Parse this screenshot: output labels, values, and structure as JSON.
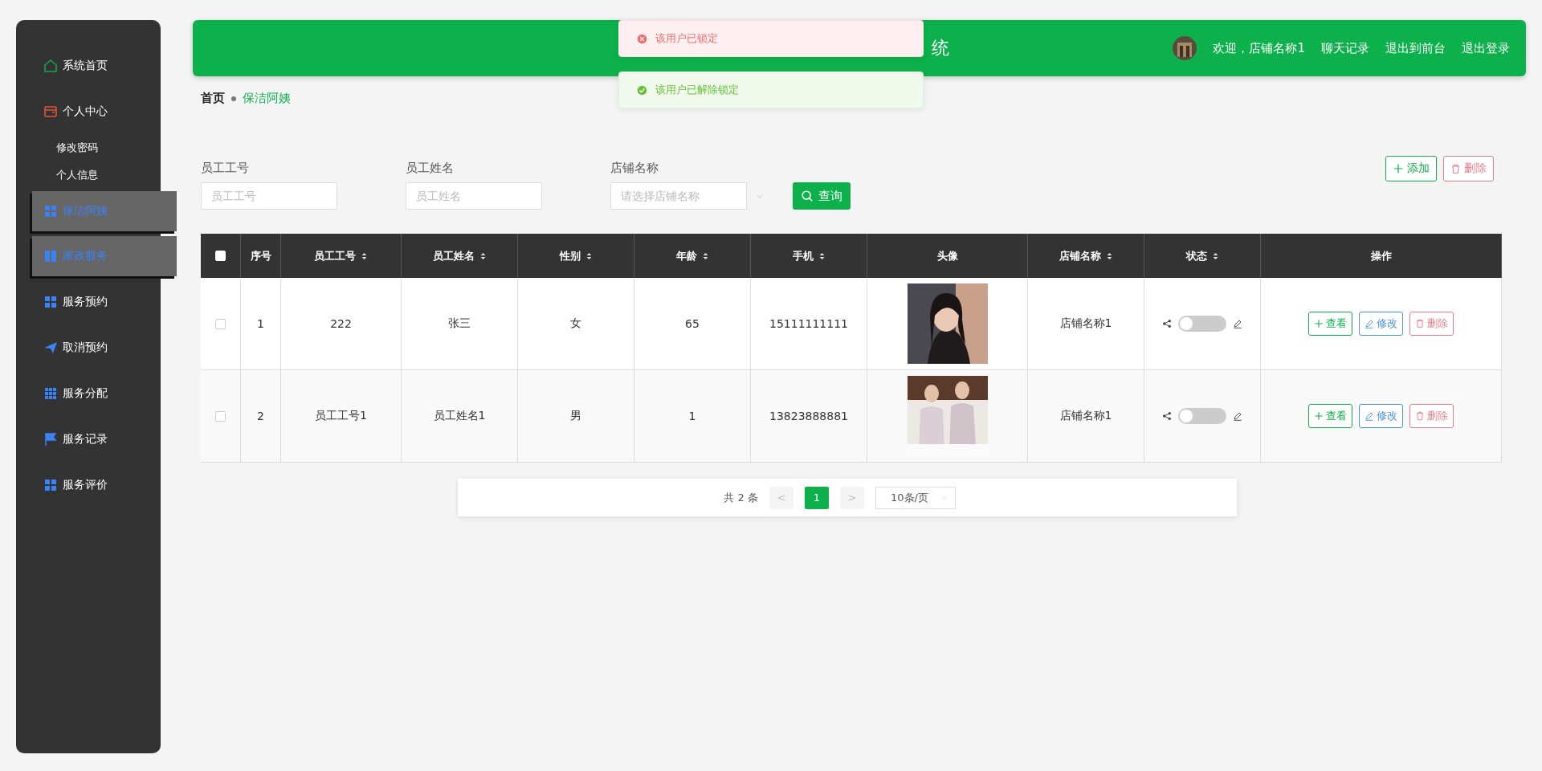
{
  "sidebar": {
    "items": [
      {
        "label": "系统首页",
        "kind": "home",
        "active": false
      },
      {
        "label": "个人中心",
        "kind": "wallet",
        "active": false,
        "children": [
          {
            "label": "修改密码"
          },
          {
            "label": "个人信息"
          }
        ]
      },
      {
        "label": "保洁阿姨",
        "kind": "grid",
        "active": true
      },
      {
        "label": "家政服务",
        "kind": "book",
        "active": true
      },
      {
        "label": "服务预约",
        "kind": "grid",
        "active": false
      },
      {
        "label": "取消预约",
        "kind": "plane",
        "active": false
      },
      {
        "label": "服务分配",
        "kind": "grid9",
        "active": false
      },
      {
        "label": "服务记录",
        "kind": "flag",
        "active": false
      },
      {
        "label": "服务评价",
        "kind": "grid",
        "active": false
      }
    ]
  },
  "header": {
    "title": "统",
    "welcome": "欢迎，店铺名称1",
    "links": [
      "聊天记录",
      "退出到前台",
      "退出登录"
    ]
  },
  "toasts": [
    {
      "kind": "error",
      "text": "该用户已锁定"
    },
    {
      "kind": "success",
      "text": "该用户已解除锁定"
    }
  ],
  "breadcrumb": {
    "home": "首页",
    "current": "保洁阿姨"
  },
  "filters": [
    {
      "label": "员工工号",
      "placeholder": "员工工号",
      "kind": "input"
    },
    {
      "label": "员工姓名",
      "placeholder": "员工姓名",
      "kind": "input"
    },
    {
      "label": "店铺名称",
      "placeholder": "请选择店铺名称",
      "kind": "select"
    }
  ],
  "search_button": "查询",
  "actions": [
    {
      "label": "添加",
      "kind": "add"
    },
    {
      "label": "删除",
      "kind": "delete"
    }
  ],
  "table": {
    "header_checkbox": {
      "checked": false
    },
    "columns": [
      {
        "label": "序号",
        "sortable": false
      },
      {
        "label": "员工工号",
        "sortable": true
      },
      {
        "label": "员工姓名",
        "sortable": true
      },
      {
        "label": "性别",
        "sortable": true
      },
      {
        "label": "年龄",
        "sortable": true
      },
      {
        "label": "手机",
        "sortable": true
      },
      {
        "label": "头像",
        "sortable": false
      },
      {
        "label": "店铺名称",
        "sortable": true
      },
      {
        "label": "状态",
        "sortable": true
      },
      {
        "label": "操作",
        "sortable": false
      }
    ],
    "rows": [
      {
        "checked": false,
        "cells": [
          "1",
          "222",
          "张三",
          "女",
          "65",
          "15111111111"
        ],
        "shop": "店铺名称1",
        "on": false,
        "buttons": [
          {
            "label": "查看",
            "kind": "view"
          },
          {
            "label": "修改",
            "kind": "edit"
          },
          {
            "label": "删除",
            "kind": "delete"
          }
        ]
      },
      {
        "checked": false,
        "cells": [
          "2",
          "员工工号1",
          "员工姓名1",
          "男",
          "1",
          "13823888881"
        ],
        "shop": "店铺名称1",
        "on": false,
        "buttons": [
          {
            "label": "查看",
            "kind": "view"
          },
          {
            "label": "修改",
            "kind": "edit"
          },
          {
            "label": "删除",
            "kind": "delete"
          }
        ]
      }
    ]
  },
  "pagination": {
    "total": "共 2 条",
    "prev": "<",
    "pages": [
      {
        "label": "1",
        "selected": true
      }
    ],
    "next": ">",
    "page_size": "10条/页"
  }
}
